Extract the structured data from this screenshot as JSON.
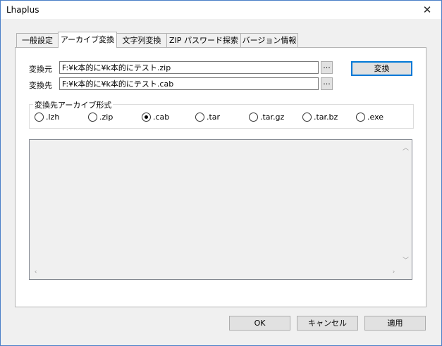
{
  "window": {
    "title": "Lhaplus"
  },
  "tabs": [
    {
      "label": "一般設定"
    },
    {
      "label": "アーカイブ変換"
    },
    {
      "label": "文字列変換"
    },
    {
      "label": "ZIP パスワード探索"
    },
    {
      "label": "バージョン情報"
    }
  ],
  "active_tab": "アーカイブ変換",
  "source": {
    "label": "変換元",
    "value": "F:¥k本的に¥k本的にテスト.zip",
    "browse": "..."
  },
  "dest": {
    "label": "変換先",
    "value": "F:¥k本的に¥k本的にテスト.cab",
    "browse": "..."
  },
  "convert_button": "変換",
  "format_group": {
    "title": "変換先アーカイブ形式",
    "options": [
      ".lzh",
      ".zip",
      ".cab",
      ".tar",
      ".tar.gz",
      ".tar.bz",
      ".exe"
    ],
    "selected": ".cab"
  },
  "footer": {
    "ok": "OK",
    "cancel": "キャンセル",
    "apply": "適用"
  },
  "colors": {
    "accent": "#0078d7",
    "window_border": "#4a7fc8"
  }
}
